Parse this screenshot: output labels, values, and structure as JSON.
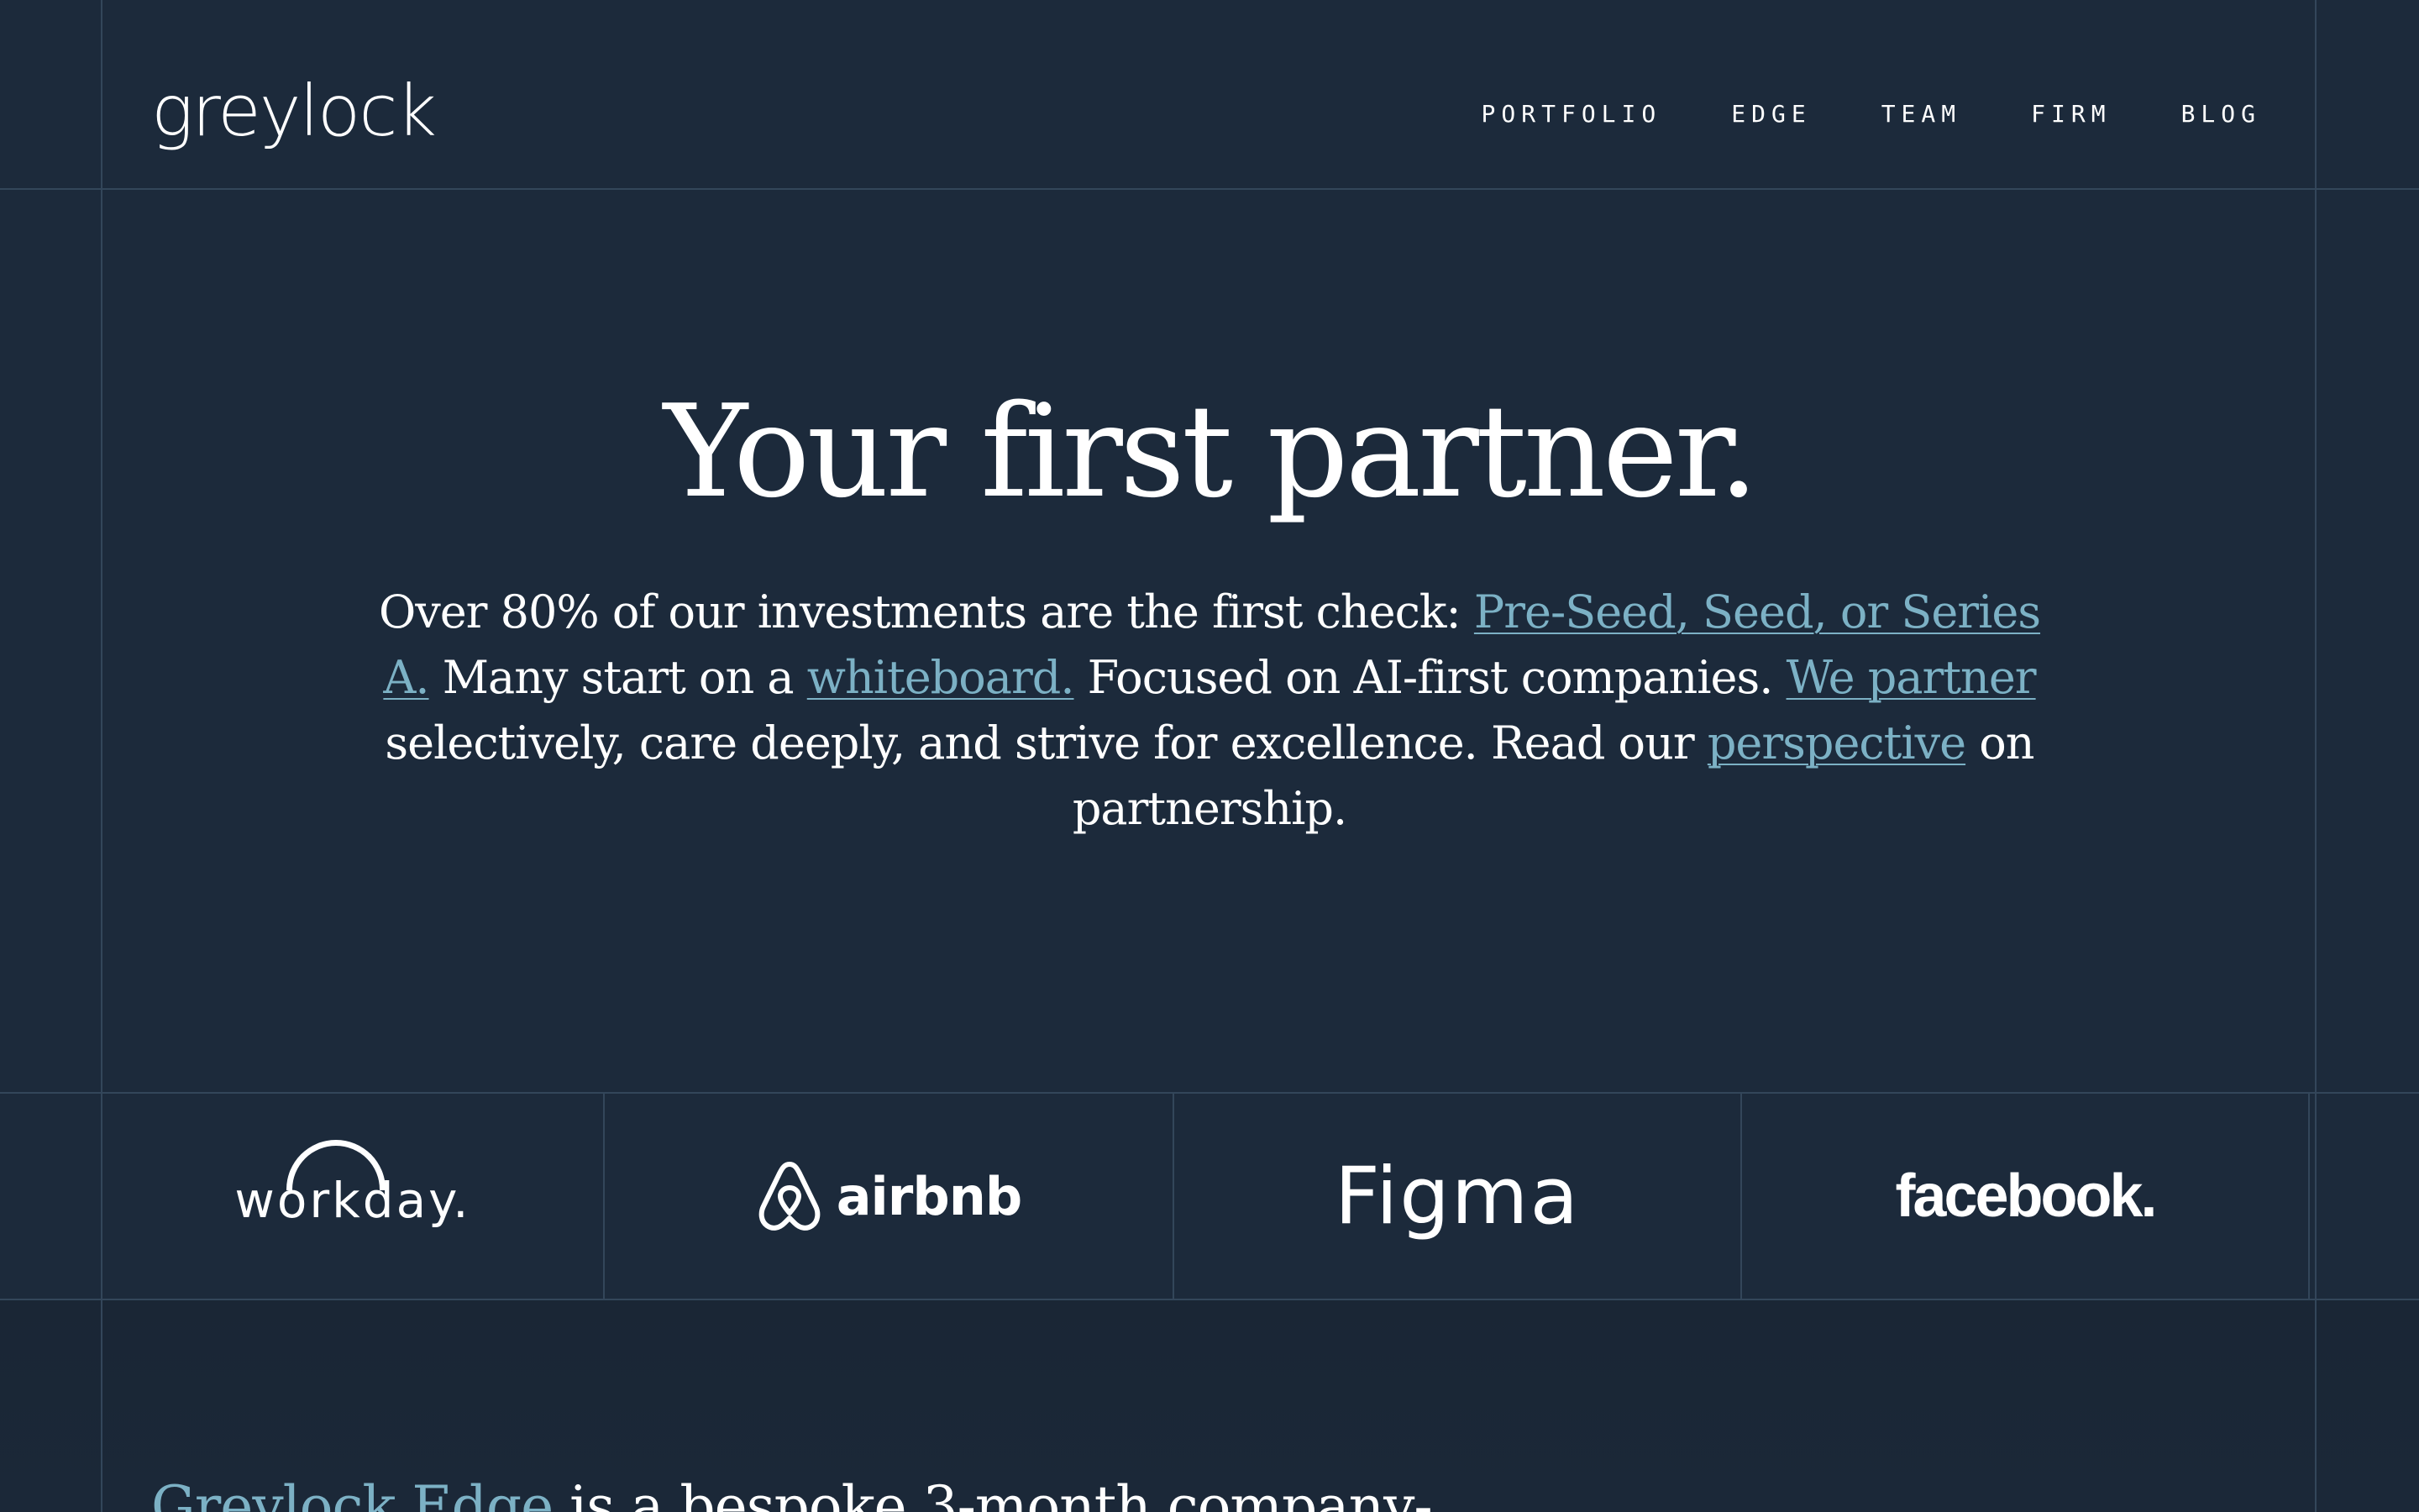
{
  "brand": {
    "logo_text": "greylock"
  },
  "nav": {
    "items": [
      {
        "label": "PORTFOLIO"
      },
      {
        "label": "EDGE"
      },
      {
        "label": "TEAM"
      },
      {
        "label": "FIRM"
      },
      {
        "label": "BLOG"
      }
    ]
  },
  "hero": {
    "title": "Your first partner.",
    "text_1": "Over 80% of our investments are the first check: ",
    "link_stages": "Pre-Seed, Seed, or Series A.",
    "text_2": " Many start on a ",
    "link_whiteboard": "whiteboard.",
    "text_3": " Focused on AI-first companies. ",
    "link_we_partner": "We partner",
    "text_4": " selectively, care deeply, and strive for excellence. Read our ",
    "link_perspective": "perspective",
    "text_5": " on partnership."
  },
  "portfolio_logos": {
    "items": [
      {
        "name": "workday."
      },
      {
        "name": "airbnb"
      },
      {
        "name": "Figma"
      },
      {
        "name": "facebook."
      }
    ]
  },
  "edge": {
    "link": "Greylock Edge",
    "text": " is a bespoke 3-month company-"
  },
  "colors": {
    "background": "#1c2a3b",
    "grid_line": "#33465a",
    "link": "#7cb1c5",
    "text": "#ffffff"
  }
}
